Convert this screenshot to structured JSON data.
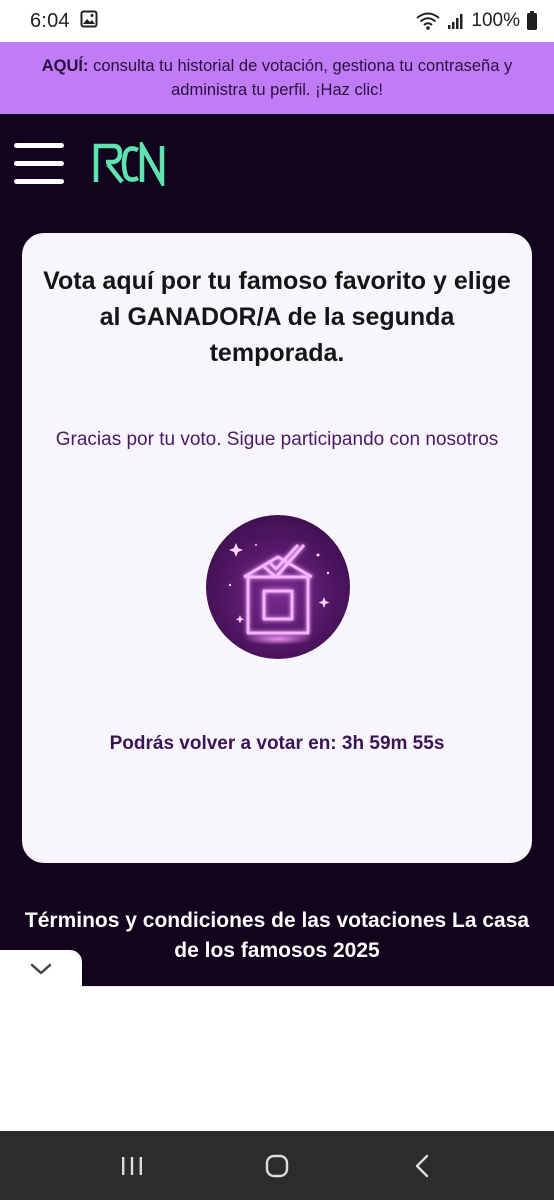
{
  "status_bar": {
    "time": "6:04",
    "battery": "100%",
    "icons": [
      "gallery-icon",
      "wifi-icon",
      "signal-icon",
      "battery-icon"
    ]
  },
  "promo": {
    "bold": "AQUÍ:",
    "text": " consulta tu historial de votación, gestiona tu contraseña y administra tu perfil. ¡Haz clic!"
  },
  "header": {
    "menu_icon": "hamburger-menu-icon",
    "logo_icon": "rcn-logo"
  },
  "card": {
    "title": "Vota aquí por tu famoso favorito y elige al GANADOR/A de la segunda temporada.",
    "thanks": "Gracias por tu voto. Sigue participando con nosotros",
    "image_icon": "ballot-box-icon",
    "timer_label": "Podrás volver a votar en:",
    "timer_value": "3h 59m 55s"
  },
  "terms": "Términos y condiciones de las votaciones La casa de los famosos 2025",
  "collapse_icon": "chevron-down-icon",
  "nav": {
    "recents_icon": "recents-icon",
    "home_icon": "home-icon",
    "back_icon": "back-icon"
  },
  "colors": {
    "promo_bg": "#bf7cf4",
    "app_bg": "#12041d",
    "card_bg": "#f8f6fc",
    "accent_text": "#4a1a66",
    "logo_green": "#5fe3b0"
  }
}
